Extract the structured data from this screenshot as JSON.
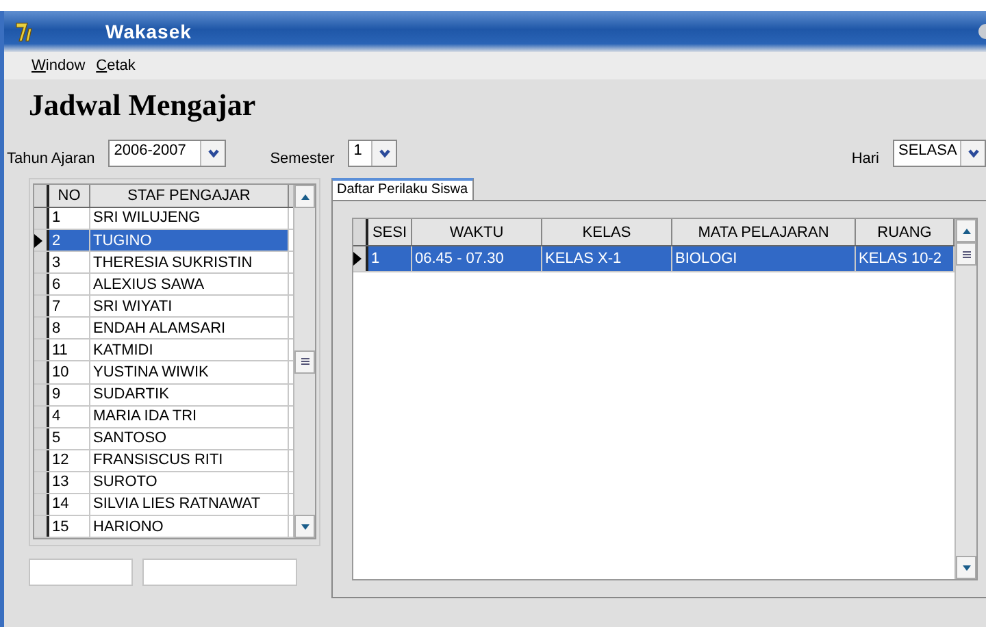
{
  "window": {
    "title": "Wakasek"
  },
  "menu": [
    {
      "label": "Window"
    },
    {
      "label": "Cetak"
    }
  ],
  "heading": "Jadwal Mengajar",
  "filters": [
    {
      "label": "Tahun Ajaran",
      "value": "2006-2007",
      "kind": "wide"
    },
    {
      "label": "Semester",
      "value": "1",
      "kind": "narrow"
    },
    {
      "label": "Hari",
      "value": "SELASA",
      "kind": "medium"
    }
  ],
  "staff_table": {
    "columns": [
      "NO",
      "STAF PENGAJAR"
    ],
    "rows": [
      {
        "no": "1",
        "name": "SRI WILUJENG",
        "selected": false
      },
      {
        "no": "2",
        "name": "TUGINO",
        "selected": true
      },
      {
        "no": "3",
        "name": "THERESIA SUKRISTIN",
        "selected": false
      },
      {
        "no": "6",
        "name": "ALEXIUS SAWA",
        "selected": false
      },
      {
        "no": "7",
        "name": "SRI WIYATI",
        "selected": false
      },
      {
        "no": "8",
        "name": "ENDAH ALAMSARI",
        "selected": false
      },
      {
        "no": "11",
        "name": "KATMIDI",
        "selected": false
      },
      {
        "no": "10",
        "name": "YUSTINA WIWIK",
        "selected": false
      },
      {
        "no": "9",
        "name": "SUDARTIK",
        "selected": false
      },
      {
        "no": "4",
        "name": "MARIA IDA TRI",
        "selected": false
      },
      {
        "no": "5",
        "name": "SANTOSO",
        "selected": false
      },
      {
        "no": "12",
        "name": "FRANSISCUS RITI",
        "selected": false
      },
      {
        "no": "13",
        "name": "SUROTO",
        "selected": false
      },
      {
        "no": "14",
        "name": "SILVIA LIES RATNAWAT",
        "selected": false
      },
      {
        "no": "15",
        "name": "HARIONO",
        "selected": false
      }
    ]
  },
  "tabs": [
    {
      "label": "Daftar Perilaku Siswa",
      "selected": true
    }
  ],
  "schedule_table": {
    "columns": [
      "SESI",
      "WAKTU",
      "KELAS",
      "MATA PELAJARAN",
      "RUANG"
    ],
    "rows": [
      {
        "cells": [
          "1",
          "06.45 - 07.30",
          "KELAS X-1",
          "BIOLOGI",
          "KELAS 10-2"
        ],
        "selected": true
      }
    ]
  }
}
